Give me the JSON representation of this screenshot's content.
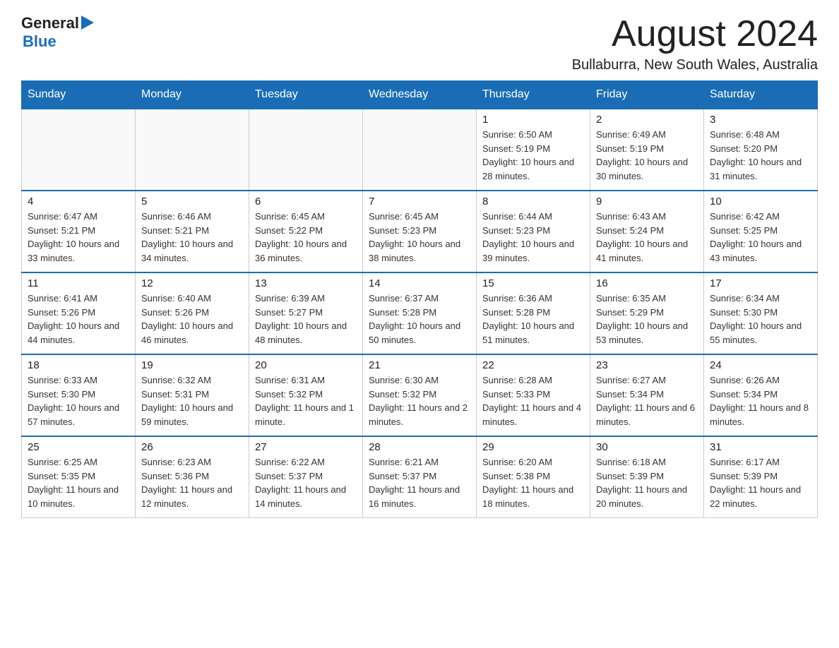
{
  "header": {
    "logo": {
      "general": "General",
      "blue": "Blue"
    },
    "month_title": "August 2024",
    "location": "Bullaburra, New South Wales, Australia"
  },
  "calendar": {
    "days_of_week": [
      "Sunday",
      "Monday",
      "Tuesday",
      "Wednesday",
      "Thursday",
      "Friday",
      "Saturday"
    ],
    "weeks": [
      [
        {
          "day": "",
          "info": ""
        },
        {
          "day": "",
          "info": ""
        },
        {
          "day": "",
          "info": ""
        },
        {
          "day": "",
          "info": ""
        },
        {
          "day": "1",
          "info": "Sunrise: 6:50 AM\nSunset: 5:19 PM\nDaylight: 10 hours and 28 minutes."
        },
        {
          "day": "2",
          "info": "Sunrise: 6:49 AM\nSunset: 5:19 PM\nDaylight: 10 hours and 30 minutes."
        },
        {
          "day": "3",
          "info": "Sunrise: 6:48 AM\nSunset: 5:20 PM\nDaylight: 10 hours and 31 minutes."
        }
      ],
      [
        {
          "day": "4",
          "info": "Sunrise: 6:47 AM\nSunset: 5:21 PM\nDaylight: 10 hours and 33 minutes."
        },
        {
          "day": "5",
          "info": "Sunrise: 6:46 AM\nSunset: 5:21 PM\nDaylight: 10 hours and 34 minutes."
        },
        {
          "day": "6",
          "info": "Sunrise: 6:45 AM\nSunset: 5:22 PM\nDaylight: 10 hours and 36 minutes."
        },
        {
          "day": "7",
          "info": "Sunrise: 6:45 AM\nSunset: 5:23 PM\nDaylight: 10 hours and 38 minutes."
        },
        {
          "day": "8",
          "info": "Sunrise: 6:44 AM\nSunset: 5:23 PM\nDaylight: 10 hours and 39 minutes."
        },
        {
          "day": "9",
          "info": "Sunrise: 6:43 AM\nSunset: 5:24 PM\nDaylight: 10 hours and 41 minutes."
        },
        {
          "day": "10",
          "info": "Sunrise: 6:42 AM\nSunset: 5:25 PM\nDaylight: 10 hours and 43 minutes."
        }
      ],
      [
        {
          "day": "11",
          "info": "Sunrise: 6:41 AM\nSunset: 5:26 PM\nDaylight: 10 hours and 44 minutes."
        },
        {
          "day": "12",
          "info": "Sunrise: 6:40 AM\nSunset: 5:26 PM\nDaylight: 10 hours and 46 minutes."
        },
        {
          "day": "13",
          "info": "Sunrise: 6:39 AM\nSunset: 5:27 PM\nDaylight: 10 hours and 48 minutes."
        },
        {
          "day": "14",
          "info": "Sunrise: 6:37 AM\nSunset: 5:28 PM\nDaylight: 10 hours and 50 minutes."
        },
        {
          "day": "15",
          "info": "Sunrise: 6:36 AM\nSunset: 5:28 PM\nDaylight: 10 hours and 51 minutes."
        },
        {
          "day": "16",
          "info": "Sunrise: 6:35 AM\nSunset: 5:29 PM\nDaylight: 10 hours and 53 minutes."
        },
        {
          "day": "17",
          "info": "Sunrise: 6:34 AM\nSunset: 5:30 PM\nDaylight: 10 hours and 55 minutes."
        }
      ],
      [
        {
          "day": "18",
          "info": "Sunrise: 6:33 AM\nSunset: 5:30 PM\nDaylight: 10 hours and 57 minutes."
        },
        {
          "day": "19",
          "info": "Sunrise: 6:32 AM\nSunset: 5:31 PM\nDaylight: 10 hours and 59 minutes."
        },
        {
          "day": "20",
          "info": "Sunrise: 6:31 AM\nSunset: 5:32 PM\nDaylight: 11 hours and 1 minute."
        },
        {
          "day": "21",
          "info": "Sunrise: 6:30 AM\nSunset: 5:32 PM\nDaylight: 11 hours and 2 minutes."
        },
        {
          "day": "22",
          "info": "Sunrise: 6:28 AM\nSunset: 5:33 PM\nDaylight: 11 hours and 4 minutes."
        },
        {
          "day": "23",
          "info": "Sunrise: 6:27 AM\nSunset: 5:34 PM\nDaylight: 11 hours and 6 minutes."
        },
        {
          "day": "24",
          "info": "Sunrise: 6:26 AM\nSunset: 5:34 PM\nDaylight: 11 hours and 8 minutes."
        }
      ],
      [
        {
          "day": "25",
          "info": "Sunrise: 6:25 AM\nSunset: 5:35 PM\nDaylight: 11 hours and 10 minutes."
        },
        {
          "day": "26",
          "info": "Sunrise: 6:23 AM\nSunset: 5:36 PM\nDaylight: 11 hours and 12 minutes."
        },
        {
          "day": "27",
          "info": "Sunrise: 6:22 AM\nSunset: 5:37 PM\nDaylight: 11 hours and 14 minutes."
        },
        {
          "day": "28",
          "info": "Sunrise: 6:21 AM\nSunset: 5:37 PM\nDaylight: 11 hours and 16 minutes."
        },
        {
          "day": "29",
          "info": "Sunrise: 6:20 AM\nSunset: 5:38 PM\nDaylight: 11 hours and 18 minutes."
        },
        {
          "day": "30",
          "info": "Sunrise: 6:18 AM\nSunset: 5:39 PM\nDaylight: 11 hours and 20 minutes."
        },
        {
          "day": "31",
          "info": "Sunrise: 6:17 AM\nSunset: 5:39 PM\nDaylight: 11 hours and 22 minutes."
        }
      ]
    ]
  }
}
